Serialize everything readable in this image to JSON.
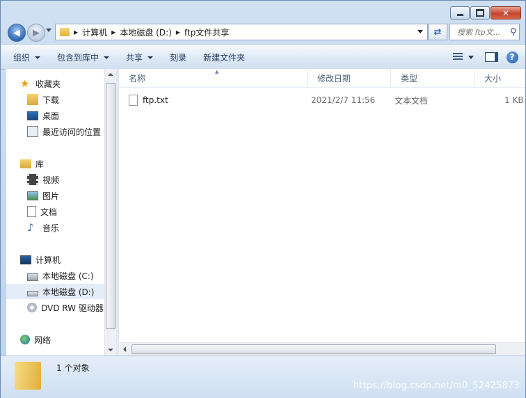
{
  "window": {
    "min_icon": "minimize-icon",
    "max_icon": "maximize-icon",
    "close_icon": "close-icon"
  },
  "address": {
    "crumbs": [
      "计算机",
      "本地磁盘 (D:)",
      "ftp文件共享"
    ],
    "search_placeholder": "搜索 ftp文..."
  },
  "toolbar": {
    "organize": "组织",
    "include_in_library": "包含到库中",
    "share": "共享",
    "burn": "刻录",
    "new_folder": "新建文件夹"
  },
  "nav": {
    "favorites": "收藏夹",
    "downloads": "下载",
    "desktop": "桌面",
    "recent": "最近访问的位置",
    "libraries": "库",
    "videos": "视频",
    "pictures": "图片",
    "documents": "文档",
    "music": "音乐",
    "computer": "计算机",
    "drive_c": "本地磁盘 (C:)",
    "drive_d": "本地磁盘 (D:)",
    "dvd": "DVD RW 驱动器",
    "network": "网络"
  },
  "columns": {
    "name": "名称",
    "modified": "修改日期",
    "type": "类型",
    "size": "大小"
  },
  "files": [
    {
      "name": "ftp.txt",
      "modified": "2021/2/7 11:56",
      "type": "文本文档",
      "size": "1 KB"
    }
  ],
  "status": {
    "count": "1 个对象"
  },
  "watermark": "https://blog.csdn.net/m0_52425873",
  "colors": {
    "accent": "#2f69b2",
    "window_frame": "#bcd2ec"
  }
}
